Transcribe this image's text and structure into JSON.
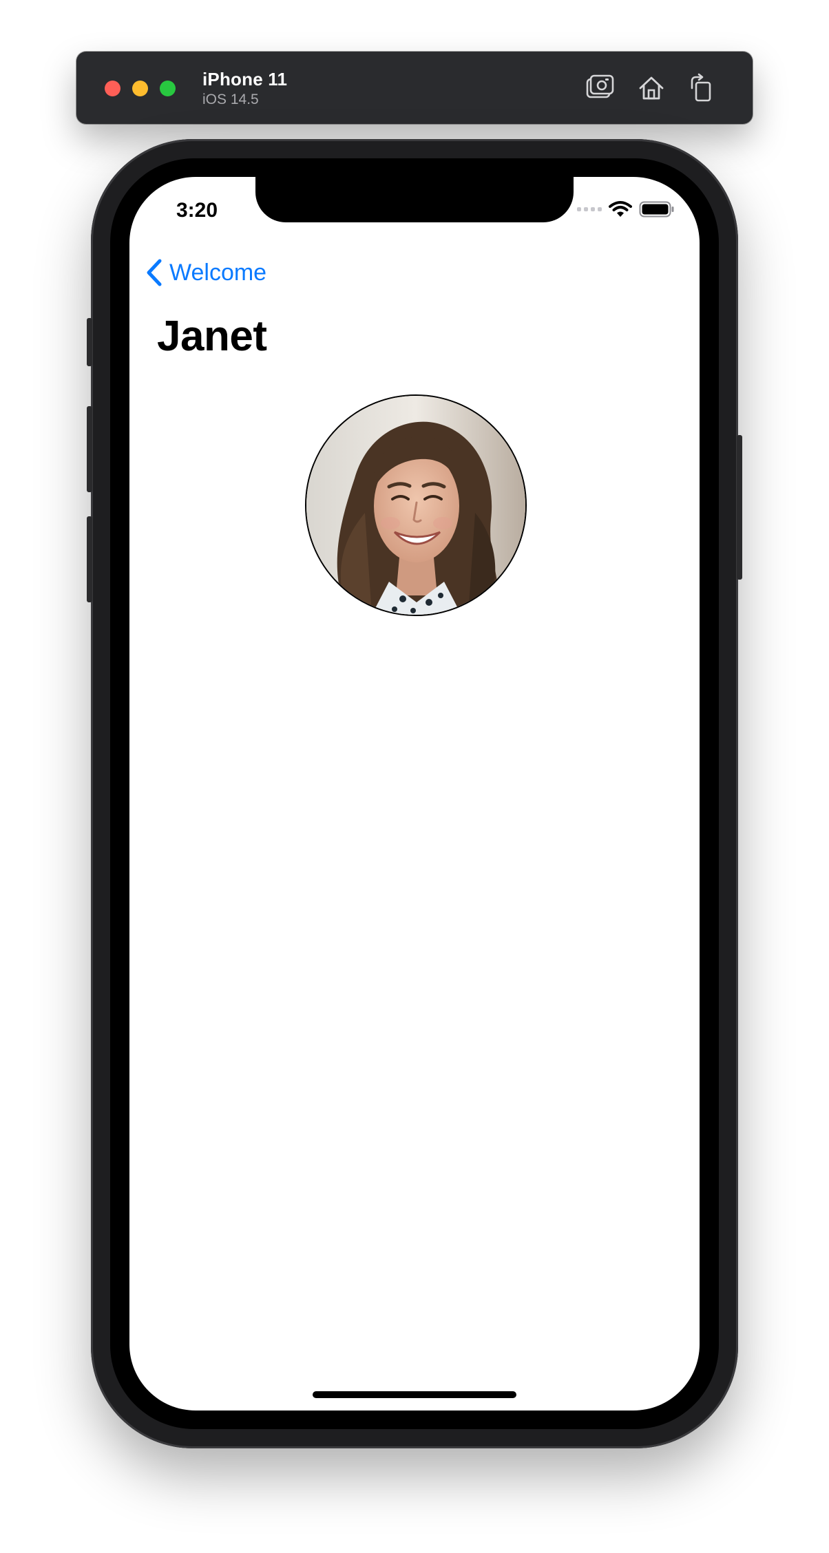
{
  "simulator": {
    "device_name": "iPhone 11",
    "os_version": "iOS 14.5",
    "toolbar": [
      {
        "icon": "screenshot-icon"
      },
      {
        "icon": "home-icon"
      },
      {
        "icon": "rotate-icon"
      }
    ]
  },
  "status_bar": {
    "time": "3:20"
  },
  "navigation": {
    "back_label": "Welcome"
  },
  "page": {
    "title": "Janet"
  },
  "profile": {
    "avatar": "profile-photo"
  },
  "colors": {
    "accent": "#0a7aff",
    "sim_bar": "#2a2b2e",
    "traffic_red": "#fe5f57",
    "traffic_yellow": "#febc2e",
    "traffic_green": "#28c840"
  }
}
